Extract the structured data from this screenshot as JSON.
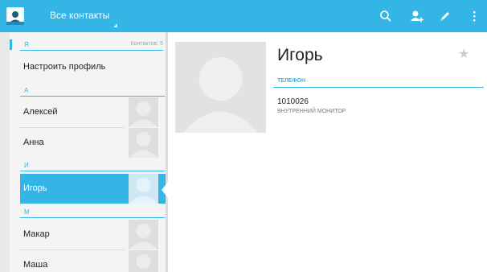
{
  "actionbar": {
    "spinner_title": "Все контакты",
    "actions": [
      "search-icon",
      "add-contact-icon",
      "edit-icon",
      "overflow-menu-icon"
    ]
  },
  "list": {
    "profile_section_letter": "Я",
    "contacts_count": "Контактов: 5",
    "profile_item": "Настроить профиль",
    "sections": [
      {
        "letter": "А",
        "rows": [
          "Алексей",
          "Анна"
        ]
      },
      {
        "letter": "И",
        "rows": [
          "Игорь"
        ]
      },
      {
        "letter": "М",
        "rows": [
          "Макар",
          "Маша"
        ]
      }
    ],
    "selected": "Игорь"
  },
  "detail": {
    "name": "Игорь",
    "phone_header": "ТЕЛЕФОН",
    "phone_number": "1010026",
    "phone_type": "ВНУТРЕННИЙ МОНИТОР",
    "starred": false
  },
  "colors": {
    "accent": "#33b5e5"
  }
}
